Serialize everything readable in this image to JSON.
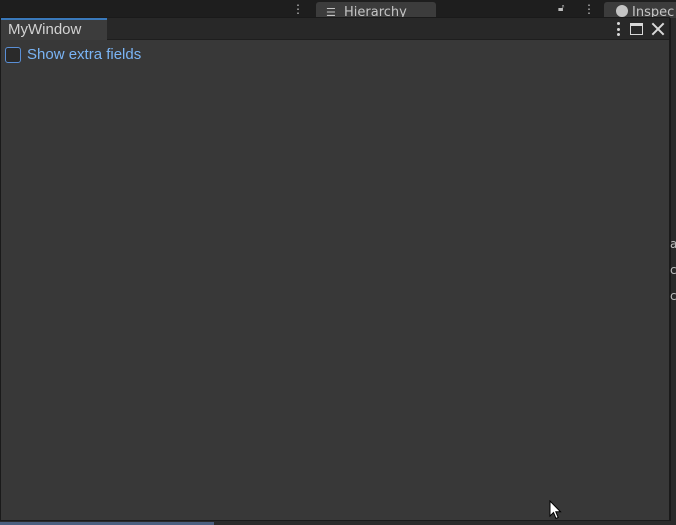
{
  "background": {
    "hierarchy_tab_label": "Hierarchy",
    "inspector_tab_label": "Inspec",
    "right_edge_chars": [
      "a",
      "c",
      "c"
    ]
  },
  "window": {
    "tab_title": "MyWindow",
    "icons": [
      "kebab-menu-icon",
      "maximize-icon",
      "close-icon"
    ],
    "accent_color": "#3a79bb"
  },
  "content": {
    "show_extra_fields": {
      "label": "Show extra fields",
      "checked": false
    }
  }
}
